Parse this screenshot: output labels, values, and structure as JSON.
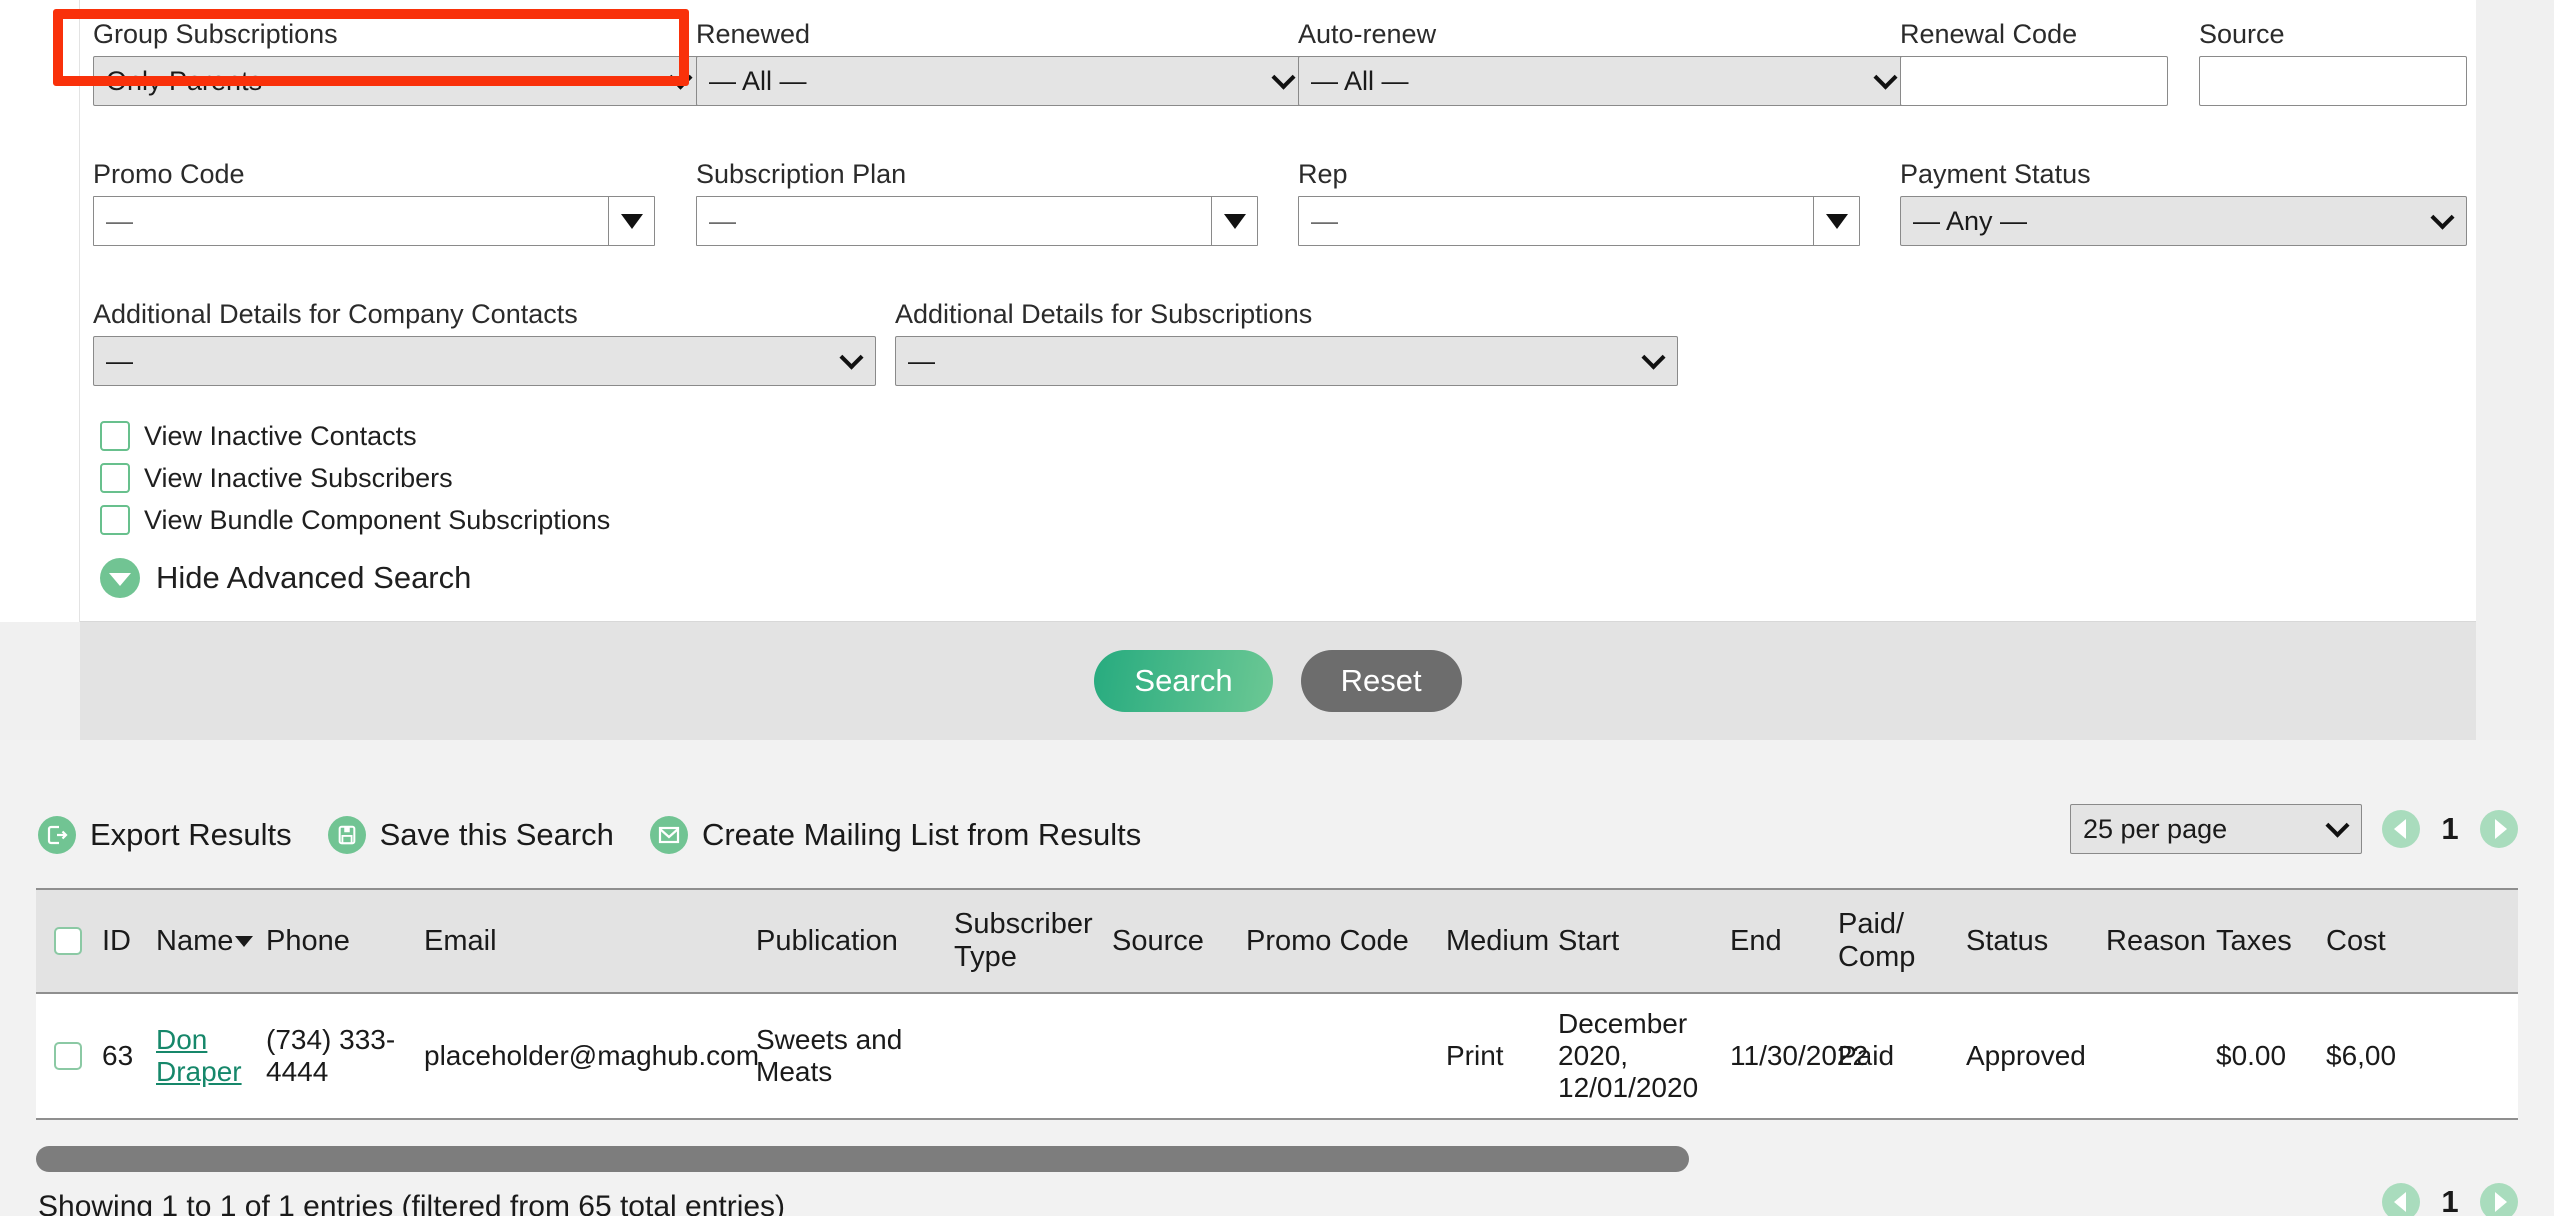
{
  "search_form": {
    "row1": [
      {
        "label": "Group Subscriptions",
        "value": "Only Parents",
        "type": "select",
        "highlighted": true
      },
      {
        "label": "Renewed",
        "value": "— All —",
        "type": "select"
      },
      {
        "label": "Auto-renew",
        "value": "— All —",
        "type": "select"
      },
      {
        "label": "Renewal Code",
        "value": "",
        "type": "text"
      },
      {
        "label": "Source",
        "value": "",
        "type": "text"
      }
    ],
    "row2": [
      {
        "label": "Promo Code",
        "value": "—",
        "type": "combo"
      },
      {
        "label": "Subscription Plan",
        "value": "—",
        "type": "combo"
      },
      {
        "label": "Rep",
        "value": "—",
        "type": "combo"
      },
      {
        "label": "Payment Status",
        "value": "— Any —",
        "type": "select"
      }
    ],
    "row3": [
      {
        "label": "Additional Details for Company Contacts",
        "value": "—",
        "type": "select"
      },
      {
        "label": "Additional Details for Subscriptions",
        "value": "—",
        "type": "select"
      }
    ],
    "checkboxes": [
      {
        "label": "View Inactive Contacts",
        "checked": false
      },
      {
        "label": "View Inactive Subscribers",
        "checked": false
      },
      {
        "label": "View Bundle Component Subscriptions",
        "checked": false
      }
    ],
    "hide_advanced_label": "Hide Advanced Search",
    "buttons": {
      "search": "Search",
      "reset": "Reset"
    }
  },
  "toolbar": {
    "export_label": "Export Results",
    "save_label": "Save this Search",
    "mailing_label": "Create Mailing List from Results"
  },
  "pagination": {
    "per_page": "25 per page",
    "current_page": "1"
  },
  "table": {
    "columns": [
      "ID",
      "Name",
      "Phone",
      "Email",
      "Publication",
      "Subscriber Type",
      "Source",
      "Promo Code",
      "Medium",
      "Start",
      "End",
      "Paid/ Comp",
      "Status",
      "Reason",
      "Taxes",
      "Cost"
    ],
    "sorted_column": "Name",
    "rows": [
      {
        "id": "63",
        "name": "Don Draper",
        "phone": "(734) 333-4444",
        "email": "placeholder@maghub.com",
        "publication": "Sweets and Meats",
        "subscriber_type": "",
        "source": "",
        "promo_code": "",
        "medium": "Print",
        "start": "December 2020, 12/01/2020",
        "end": "11/30/2022",
        "paid_comp": "Paid",
        "status": "Approved",
        "reason": "",
        "taxes": "$0.00",
        "cost": "$6,00"
      }
    ]
  },
  "footer": {
    "entries_text": "Showing 1 to 1 of 1 entries (filtered from 65 total entries)",
    "page_number": "1"
  },
  "colors": {
    "accent_green": "#71c493",
    "link_green": "#16876a",
    "highlight_red": "#f9310a",
    "reset_gray": "#6d6d6d"
  }
}
